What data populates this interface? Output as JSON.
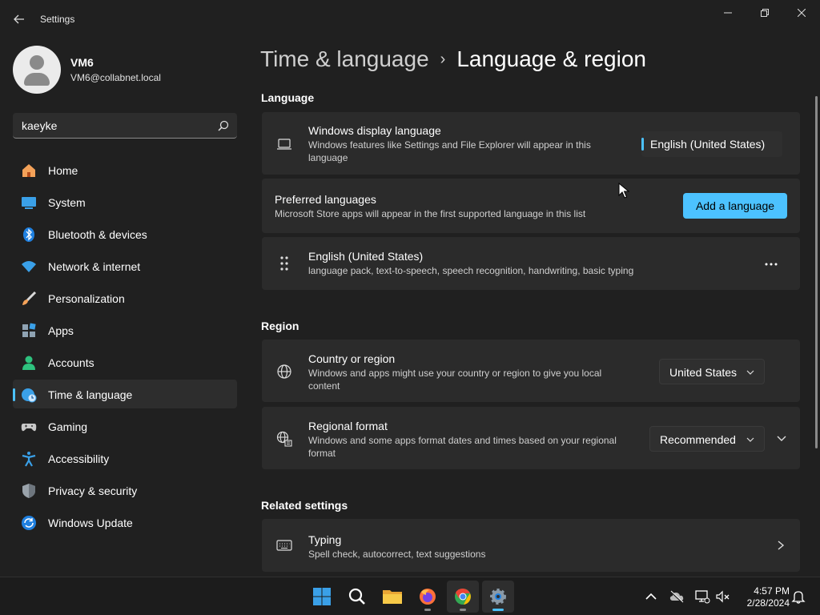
{
  "window": {
    "title": "Settings"
  },
  "profile": {
    "name": "VM6",
    "email": "VM6@collabnet.local"
  },
  "search": {
    "value": "kaeyke"
  },
  "sidebar": {
    "items": [
      {
        "label": "Home",
        "icon": "home-icon"
      },
      {
        "label": "System",
        "icon": "system-icon"
      },
      {
        "label": "Bluetooth & devices",
        "icon": "bluetooth-icon"
      },
      {
        "label": "Network & internet",
        "icon": "network-icon"
      },
      {
        "label": "Personalization",
        "icon": "brush-icon"
      },
      {
        "label": "Apps",
        "icon": "apps-icon"
      },
      {
        "label": "Accounts",
        "icon": "accounts-icon"
      },
      {
        "label": "Time & language",
        "icon": "time-language-icon",
        "selected": true
      },
      {
        "label": "Gaming",
        "icon": "gaming-icon"
      },
      {
        "label": "Accessibility",
        "icon": "accessibility-icon"
      },
      {
        "label": "Privacy & security",
        "icon": "shield-icon"
      },
      {
        "label": "Windows Update",
        "icon": "update-icon"
      }
    ]
  },
  "breadcrumb": {
    "parent": "Time & language",
    "separator": "›",
    "current": "Language & region"
  },
  "language": {
    "section_title": "Language",
    "display": {
      "title": "Windows display language",
      "subtitle": "Windows features like Settings and File Explorer will appear in this language",
      "value": "English (United States)"
    },
    "preferred": {
      "title": "Preferred languages",
      "subtitle": "Microsoft Store apps will appear in the first supported language in this list",
      "button": "Add a language"
    },
    "installed": {
      "title": "English (United States)",
      "subtitle": "language pack, text-to-speech, speech recognition, handwriting, basic typing"
    }
  },
  "region": {
    "section_title": "Region",
    "country": {
      "title": "Country or region",
      "subtitle": "Windows and apps might use your country or region to give you local content",
      "value": "United States"
    },
    "format": {
      "title": "Regional format",
      "subtitle": "Windows and some apps format dates and times based on your regional format",
      "value": "Recommended"
    }
  },
  "related": {
    "section_title": "Related settings",
    "typing": {
      "title": "Typing",
      "subtitle": "Spell check, autocorrect, text suggestions"
    }
  },
  "taskbar": {
    "time": "4:57 PM",
    "date": "2/28/2024"
  },
  "colors": {
    "accent": "#4cc2ff",
    "background": "#202020",
    "card": "#2b2b2b"
  }
}
